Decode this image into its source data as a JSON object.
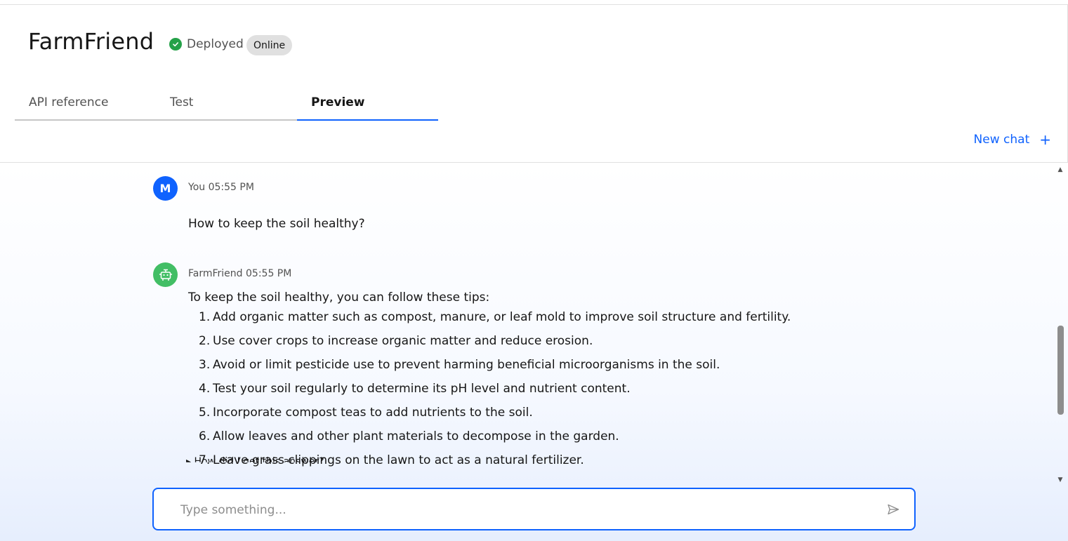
{
  "header": {
    "title": "FarmFriend",
    "status": "Deployed",
    "badge": "Online"
  },
  "tabs": [
    {
      "label": "API reference",
      "active": false
    },
    {
      "label": "Test",
      "active": false
    },
    {
      "label": "Preview",
      "active": true
    }
  ],
  "new_chat": {
    "label": "New chat",
    "icon": "plus-icon"
  },
  "messages": {
    "user": {
      "avatar": "M",
      "author": "You",
      "time": "05:55 PM",
      "text": "How to keep the soil healthy?"
    },
    "bot": {
      "avatar_icon": "robot-icon",
      "author": "FarmFriend",
      "time": "05:55 PM",
      "intro": "To keep the soil healthy, you can follow these tips:",
      "tips": [
        "Add organic matter such as compost, manure, or leaf mold to improve soil structure and fertility.",
        "Use cover crops to increase organic matter and reduce erosion.",
        "Avoid or limit pesticide use to prevent harming beneficial microorganisms in the soil.",
        "Test your soil regularly to determine its pH level and nutrient content.",
        "Incorporate compost teas to add nutrients to the soil.",
        "Allow leaves and other plant materials to decompose in the garden.",
        "Leave grass clippings on the lawn to act as a natural fertilizer."
      ],
      "overlay_link": "How did I get this answer?"
    }
  },
  "composer": {
    "placeholder": "Type something...",
    "value": "",
    "send_icon": "send-icon"
  },
  "colors": {
    "accent": "#0f62fe",
    "status_green": "#24a148",
    "bot_avatar": "#42be65"
  }
}
